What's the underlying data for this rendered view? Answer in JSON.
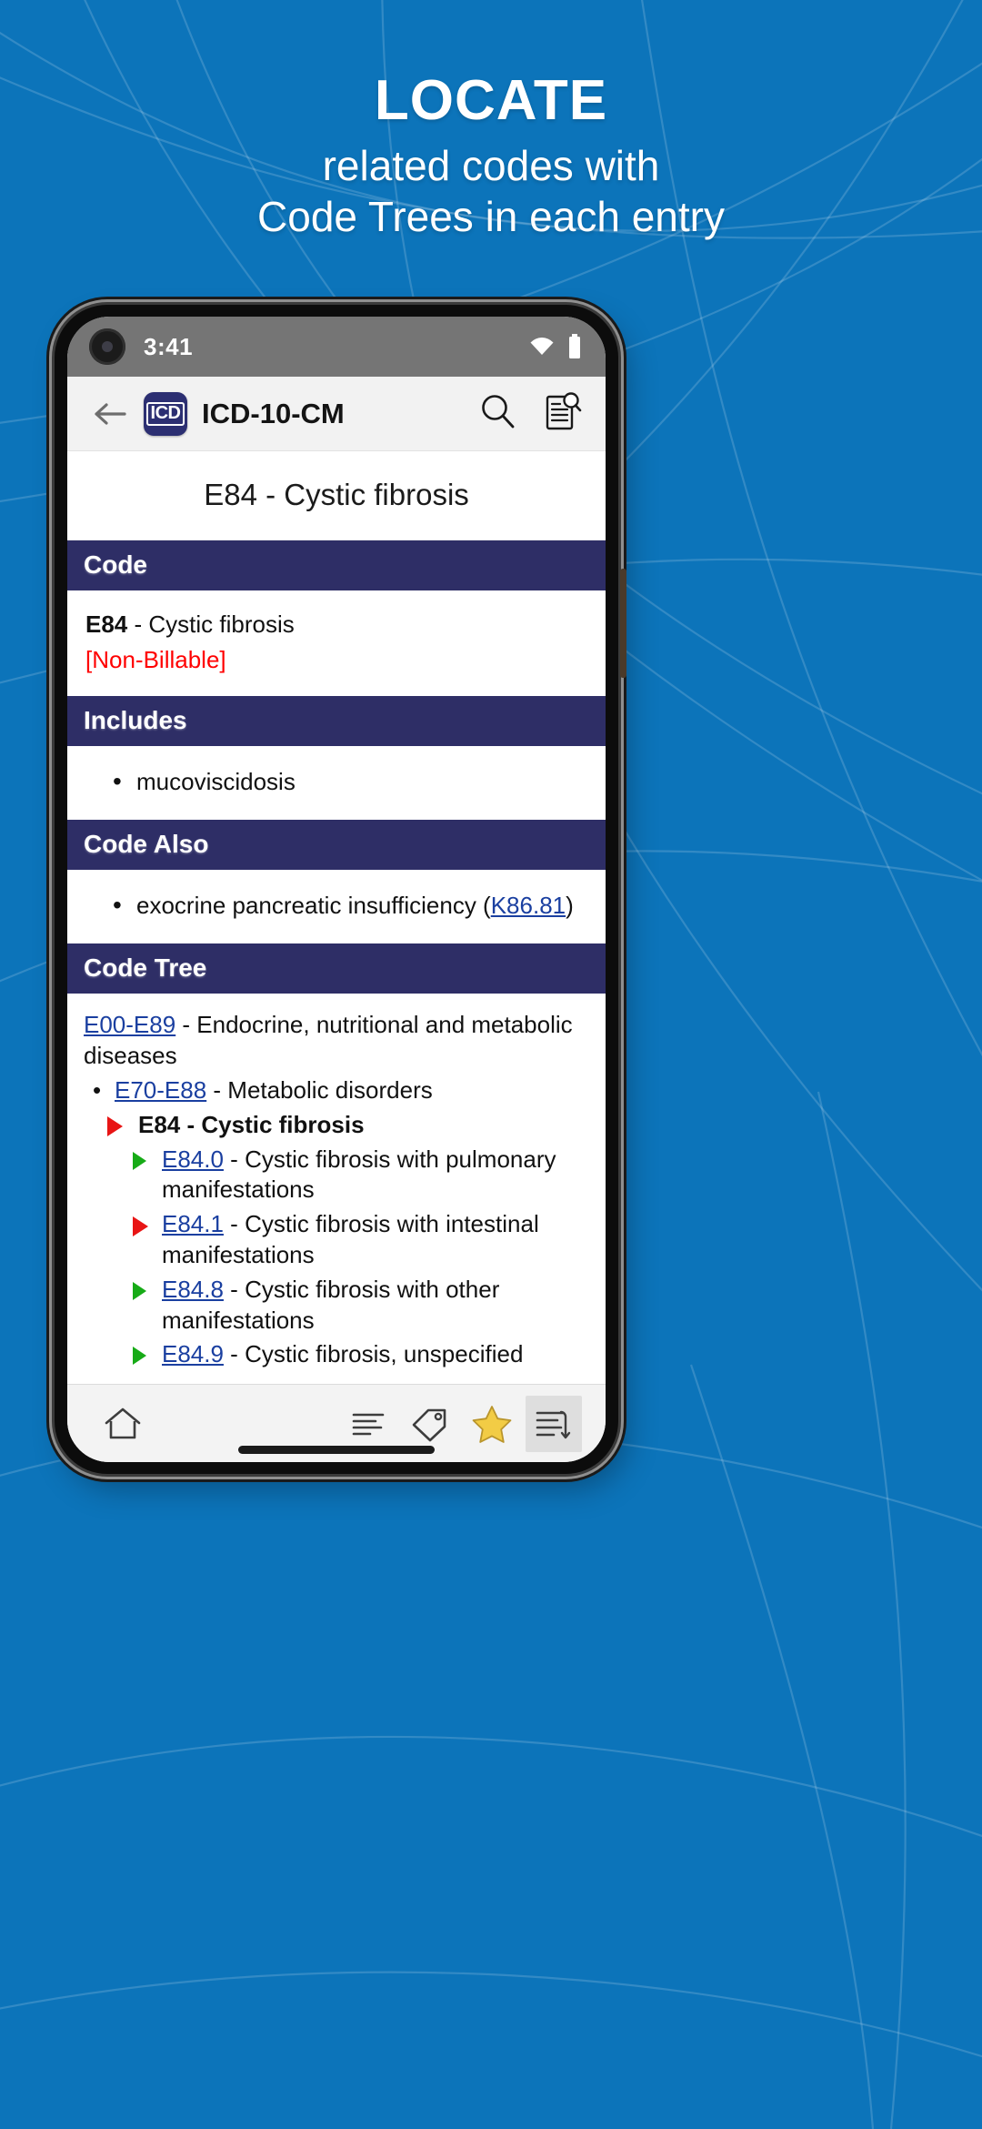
{
  "promo": {
    "title": "LOCATE",
    "subtitle_line1": "related codes with",
    "subtitle_line2": "Code Trees in each entry",
    "background_color": "#0c74ba",
    "text_color": "#ffffff"
  },
  "statusbar": {
    "time": "3:41",
    "wifi_icon": "wifi-icon",
    "battery_icon": "battery-icon",
    "background_color": "#757575"
  },
  "toolbar": {
    "back_icon": "back-arrow-icon",
    "app_badge_label": "ICD",
    "title": "ICD-10-CM",
    "search_icon": "search-icon",
    "document_search_icon": "document-search-icon",
    "background_color": "#f2f2f2",
    "badge_color": "#2c2f72"
  },
  "entry": {
    "title": "E84 - Cystic fibrosis",
    "section_header_color": "#2e2e66",
    "link_color": "#1a3fa0",
    "alert_color": "#ff0000"
  },
  "sections": {
    "code": {
      "header": "Code",
      "code": "E84",
      "separator": " - ",
      "description": "Cystic fibrosis",
      "billable_status": "[Non-Billable]"
    },
    "includes": {
      "header": "Includes",
      "items": [
        "mucoviscidosis"
      ]
    },
    "code_also": {
      "header": "Code Also",
      "item_text_before": "exocrine pancreatic insufficiency (",
      "item_link": "K86.81",
      "item_text_after": ")"
    },
    "code_tree": {
      "header": "Code Tree",
      "root": {
        "code": "E00-E89",
        "separator": " - ",
        "label": "Endocrine, nutritional and metabolic diseases"
      },
      "level1": {
        "code": "E70-E88",
        "separator": " - ",
        "label": "Metabolic disorders"
      },
      "current": {
        "marker": "red",
        "code": "E84",
        "separator": " - ",
        "label": "Cystic fibrosis"
      },
      "children": [
        {
          "marker": "green",
          "code": "E84.0",
          "separator": " - ",
          "label": "Cystic fibrosis with pulmonary manifestations"
        },
        {
          "marker": "red",
          "code": "E84.1",
          "separator": " - ",
          "label": "Cystic fibrosis with intestinal manifestations"
        },
        {
          "marker": "green",
          "code": "E84.8",
          "separator": " - ",
          "label": "Cystic fibrosis with other manifestations"
        },
        {
          "marker": "green",
          "code": "E84.9",
          "separator": " - ",
          "label": "Cystic fibrosis, unspecified"
        }
      ]
    }
  },
  "bottomnav": {
    "home_icon": "home-icon",
    "list_icon": "list-icon",
    "tag_icon": "tag-icon",
    "star_icon": "star-favorite-icon",
    "tree_icon": "code-tree-icon",
    "active_item": "code-tree-icon",
    "star_color": "#f2cc45"
  }
}
